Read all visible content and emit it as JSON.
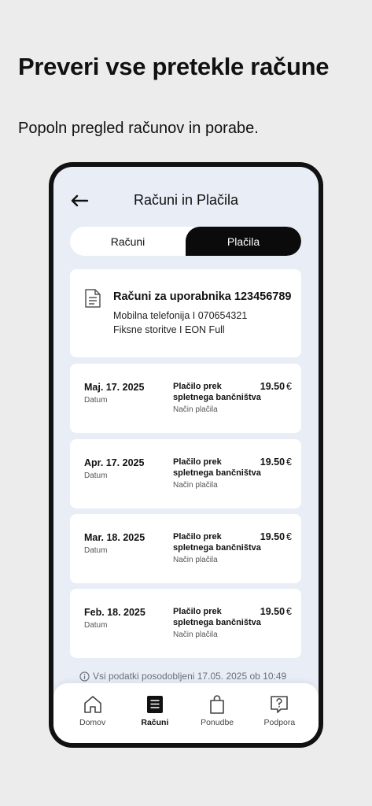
{
  "promo": {
    "title": "Preveri vse pretekle račune",
    "subtitle": "Popoln pregled računov in porabe."
  },
  "header": {
    "title": "Računi in Plačila",
    "back_icon": "arrow-left-icon"
  },
  "segments": {
    "left": "Računi",
    "right": "Plačila",
    "active": "right"
  },
  "account": {
    "icon": "document-icon",
    "title": "Računi za uporabnika 123456789",
    "line1": "Mobilna telefonija I 070654321",
    "line2": "Fiksne storitve I EON Full"
  },
  "payments": [
    {
      "date": "Maj. 17. 2025",
      "date_label": "Datum",
      "method": "Plačilo prek spletnega bančništva",
      "method_label": "Način plačila",
      "amount": "19.50",
      "currency": "€"
    },
    {
      "date": "Apr. 17. 2025",
      "date_label": "Datum",
      "method": "Plačilo prek spletnega bančništva",
      "method_label": "Način plačila",
      "amount": "19.50",
      "currency": "€"
    },
    {
      "date": "Mar. 18. 2025",
      "date_label": "Datum",
      "method": "Plačilo prek spletnega bančništva",
      "method_label": "Način plačila",
      "amount": "19.50",
      "currency": "€"
    },
    {
      "date": "Feb. 18. 2025",
      "date_label": "Datum",
      "method": "Plačilo prek spletnega bančništva",
      "method_label": "Način plačila",
      "amount": "19.50",
      "currency": "€"
    }
  ],
  "update_note": "Vsi podatki posodobljeni 17.05. 2025 ob 10:49",
  "tabbar": {
    "items": [
      {
        "label": "Domov",
        "icon": "home-icon"
      },
      {
        "label": "Računi",
        "icon": "bill-icon"
      },
      {
        "label": "Ponudbe",
        "icon": "shopping-bag-icon"
      },
      {
        "label": "Podpora",
        "icon": "help-icon"
      }
    ],
    "active": "Računi"
  },
  "colors": {
    "background": "#ececec",
    "screen": "#e8edf6",
    "accent": "#0b0b0b"
  }
}
